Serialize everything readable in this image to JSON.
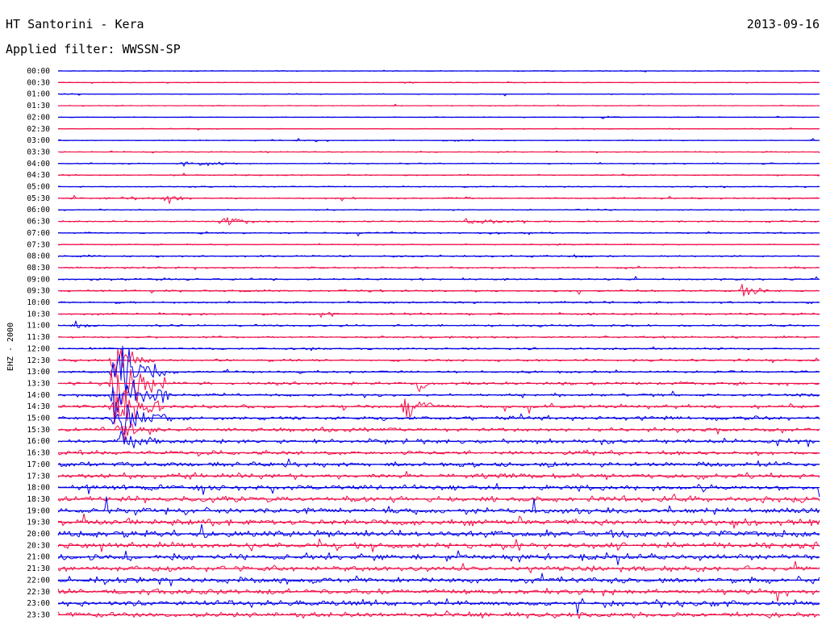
{
  "header": {
    "station": "HT Santorini - Kera",
    "date": "2013-09-16",
    "filter": "Applied filter: WWSSN-SP",
    "channel": "EHZ - 2000"
  },
  "chart_data": {
    "type": "line",
    "title": "HT Santorini - Kera",
    "subtitle": "Applied filter: WWSSN-SP",
    "date": "2013-09-16",
    "ylabel": "EHZ - 2000",
    "xlabel": "",
    "x_unit": "minutes after row start",
    "xlim": [
      0,
      30
    ],
    "row_labels": [
      "00:00",
      "00:30",
      "01:00",
      "01:30",
      "02:00",
      "02:30",
      "03:00",
      "03:30",
      "04:00",
      "04:30",
      "05:00",
      "05:30",
      "06:00",
      "06:30",
      "07:00",
      "07:30",
      "08:00",
      "08:30",
      "09:00",
      "09:30",
      "10:00",
      "10:30",
      "11:00",
      "11:30",
      "12:00",
      "12:30",
      "13:00",
      "13:30",
      "14:00",
      "14:30",
      "15:00",
      "15:30",
      "16:00",
      "16:30",
      "17:00",
      "17:30",
      "18:00",
      "18:30",
      "19:00",
      "19:30",
      "20:00",
      "20:30",
      "21:00",
      "21:30",
      "22:00",
      "22:30",
      "23:00",
      "23:30"
    ],
    "row_colors": [
      "#0000e6",
      "#f0104a"
    ],
    "noise_level": [
      0.4,
      0.4,
      0.4,
      0.4,
      0.4,
      0.5,
      0.5,
      0.5,
      0.6,
      0.6,
      0.6,
      0.8,
      0.6,
      0.8,
      0.8,
      0.6,
      0.8,
      0.8,
      1.0,
      1.0,
      1.0,
      1.0,
      1.0,
      1.0,
      1.0,
      1.2,
      1.2,
      1.5,
      1.5,
      1.8,
      2.0,
      2.0,
      2.2,
      2.2,
      2.5,
      2.8,
      2.8,
      3.0,
      3.2,
      3.2,
      3.4,
      3.2,
      3.2,
      3.0,
      3.0,
      2.8,
      2.8,
      2.8
    ],
    "events": [
      {
        "row": "00:30",
        "start_min": 13.5,
        "duration_min": 0.6,
        "amplitude": 1.5
      },
      {
        "row": "04:00",
        "start_min": 4.6,
        "duration_min": 2.5,
        "amplitude": 2.5
      },
      {
        "row": "04:00",
        "start_min": 6.2,
        "duration_min": 1.2,
        "amplitude": 2.0
      },
      {
        "row": "02:00",
        "start_min": 21.3,
        "duration_min": 1.0,
        "amplitude": 1.5
      },
      {
        "row": "03:00",
        "start_min": 15.6,
        "duration_min": 0.5,
        "amplitude": 2.0
      },
      {
        "row": "05:30",
        "start_min": 2.3,
        "duration_min": 3.0,
        "amplitude": 1.2
      },
      {
        "row": "05:30",
        "start_min": 4.0,
        "duration_min": 1.3,
        "amplitude": 6.5
      },
      {
        "row": "06:30",
        "start_min": 6.3,
        "duration_min": 1.5,
        "amplitude": 8.0
      },
      {
        "row": "06:30",
        "start_min": 15.7,
        "duration_min": 2.6,
        "amplitude": 3.5
      },
      {
        "row": "08:00",
        "start_min": 20.0,
        "duration_min": 1.0,
        "amplitude": 2.5
      },
      {
        "row": "09:30",
        "start_min": 26.8,
        "duration_min": 1.3,
        "amplitude": 8.0
      },
      {
        "row": "11:00",
        "start_min": 0.5,
        "duration_min": 0.8,
        "amplitude": 5.0
      },
      {
        "row": "12:30",
        "start_min": 2.0,
        "duration_min": 1.8,
        "amplitude": 20.0
      },
      {
        "row": "13:00",
        "start_min": 2.0,
        "duration_min": 2.2,
        "amplitude": 40.0
      },
      {
        "row": "13:30",
        "start_min": 2.0,
        "duration_min": 2.2,
        "amplitude": 45.0
      },
      {
        "row": "14:00",
        "start_min": 2.0,
        "duration_min": 2.5,
        "amplitude": 40.0
      },
      {
        "row": "14:30",
        "start_min": 2.0,
        "duration_min": 2.2,
        "amplitude": 30.0
      },
      {
        "row": "15:00",
        "start_min": 2.0,
        "duration_min": 2.5,
        "amplitude": 22.0
      },
      {
        "row": "15:30",
        "start_min": 2.2,
        "duration_min": 2.0,
        "amplitude": 14.0
      },
      {
        "row": "16:00",
        "start_min": 2.2,
        "duration_min": 2.0,
        "amplitude": 10.0
      },
      {
        "row": "14:30",
        "start_min": 13.5,
        "duration_min": 1.3,
        "amplitude": 14.0
      },
      {
        "row": "13:30",
        "start_min": 14.1,
        "duration_min": 0.5,
        "amplitude": 18.0
      }
    ]
  }
}
